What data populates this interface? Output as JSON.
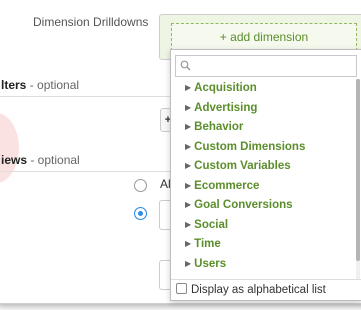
{
  "drilldowns": {
    "label": "Dimension Drilldowns",
    "add_label": "+ add dimension"
  },
  "filters": {
    "title": "lters",
    "suffix": " - optional",
    "button_glyph": "+"
  },
  "views": {
    "title": "iews",
    "suffix": " - optional",
    "all_label": "Al"
  },
  "dropdown": {
    "search_placeholder": "",
    "items": [
      {
        "label": "Acquisition"
      },
      {
        "label": "Advertising"
      },
      {
        "label": "Behavior"
      },
      {
        "label": "Custom Dimensions"
      },
      {
        "label": "Custom Variables"
      },
      {
        "label": "Ecommerce"
      },
      {
        "label": "Goal Conversions"
      },
      {
        "label": "Social"
      },
      {
        "label": "Time"
      },
      {
        "label": "Users"
      }
    ],
    "footer_label": "Display as alphabetical list",
    "alphabetical_checked": false
  },
  "colors": {
    "accent_green": "#5b8e2b",
    "radio_blue": "#2e8be6"
  }
}
